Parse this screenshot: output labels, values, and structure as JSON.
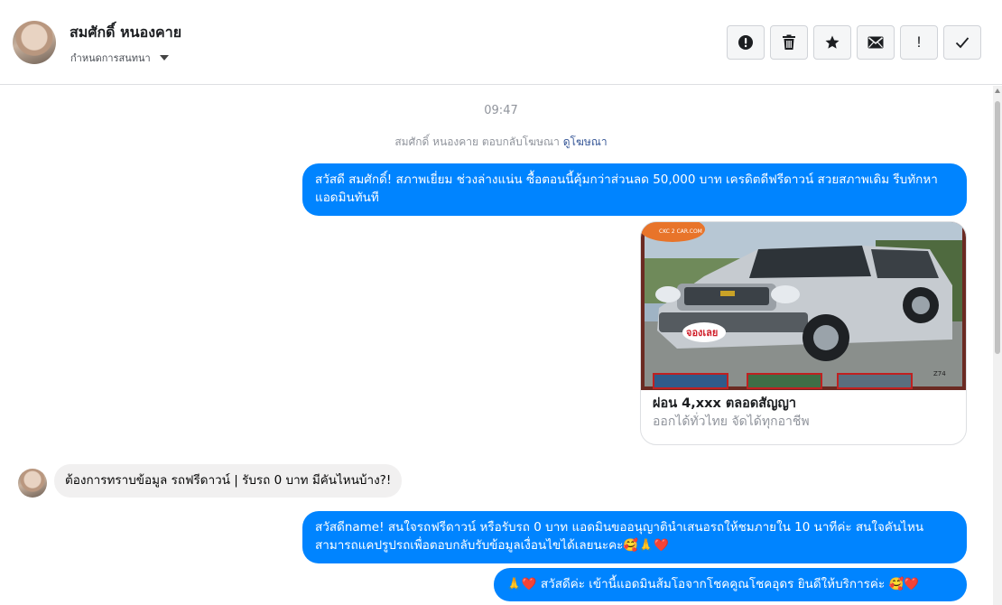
{
  "header": {
    "contact_name": "สมศักดิ์ หนองคาย",
    "subtitle": "กำหนดการสนทนา",
    "toolbar": [
      {
        "icon": "exclamation-circle-icon"
      },
      {
        "icon": "trash-icon"
      },
      {
        "icon": "star-icon"
      },
      {
        "icon": "envelope-icon"
      },
      {
        "icon": "exclamation-icon",
        "label": "!"
      },
      {
        "icon": "checkmark-icon"
      }
    ]
  },
  "conversation": {
    "timestamp": "09:47",
    "replied_text": "สมศักดิ์ หนองคาย ตอบกลับโฆษณา",
    "replied_link": "ดูโฆษณา",
    "messages": [
      {
        "text": "สวัสดี สมศักดิ์!  สภาพเยี่ยม ช่วงล่างแน่น  ซื้อตอนนี้คุ้มกว่าส่วนลด 50,000 บาท เครดิตดีฟรีดาวน์  สวยสภาพเดิม รีบทักหาแอดมินทันที"
      },
      {
        "text": "ต้องการทราบข้อมูล รถฟรีดาวน์ | รับรถ 0 บาท มีคันไหนบ้าง?!"
      },
      {
        "text": "สวัสดีname! สนใจรถฟรีดาวน์ หรือรับรถ 0 บาท แอดมินขออนุญาตินำเสนอรถให้ชมภายใน 10 นาทีค่ะ สนใจคันไหนสามารถแคปรูปรถเพื่อตอบกลับรับข้อมูลเงื่อนไขได้เลยนะคะ🥰🙏❤️"
      },
      {
        "text": "🙏❤️ สวัสดีค่ะ เข้านี้แอดมินส้มโอจากโชคคูณโชคอุดร ยินดีให้บริการค่ะ  🥰❤️"
      }
    ],
    "ad_card": {
      "title": "ผ่อน 4,xxx ตลอดสัญญา",
      "subtitle": "ออกได้ทั่วไทย จัดได้ทุกอาชีพ",
      "image_badge": "จองเลย",
      "image_logo": "CKC 2 CAR.COM",
      "image_code": "Z74"
    }
  }
}
